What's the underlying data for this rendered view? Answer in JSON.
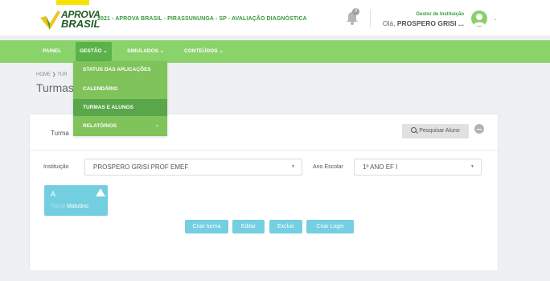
{
  "header": {
    "logo_line1": "APROVA",
    "logo_line2": "BRASIL",
    "title": "2021 - APROVA BRASIL - PIRASSUNUNGA - SP - AVALIAÇÃO DIAGNÓSTICA",
    "notification_count": "0",
    "institution_label": "Gestor de Instituição",
    "greeting_prefix": "Olá,",
    "user_name": "PROSPERO GRISI ..."
  },
  "nav": {
    "items": [
      {
        "label": "PAINEL"
      },
      {
        "label": "GESTÃO ⌄"
      },
      {
        "label": "SIMULADOS ⌄"
      },
      {
        "label": "CONTEÚDOS ⌄"
      }
    ]
  },
  "dropdown": {
    "items": [
      {
        "label": "STATUS DAS APLICAÇÕES"
      },
      {
        "label": "CALENDÁRIO"
      },
      {
        "label": "TURMAS E ALUNOS"
      },
      {
        "label": "RELATÓRIOS"
      }
    ],
    "relatorios_chevron": "⌄"
  },
  "page": {
    "breadcrumb": "HOME ❯ TUR",
    "title": "Turmas"
  },
  "card": {
    "title": "Turma",
    "search_button": "Pesquisar Aluno",
    "institution_label": "Instituição",
    "institution_value": "PROSPERO GRISI PROF EMEF",
    "grade_label": "Ano Escolar",
    "grade_value": "1º ANO EF I",
    "caret": "▼",
    "class_letter": "A",
    "class_turno_prefix": "Turno",
    "class_turno": "Matutino",
    "buttons": {
      "create_class": "Criar turma",
      "edit": "Editar",
      "delete": "Excluir",
      "create_login": "Criar Login"
    }
  },
  "colors": {
    "nav_green": "#8ad36b",
    "active_green": "#5cb24a",
    "brand_dark_green": "#1f5a25",
    "accent_cyan": "#74cfe1",
    "logo_highlight": "#f7e300"
  }
}
